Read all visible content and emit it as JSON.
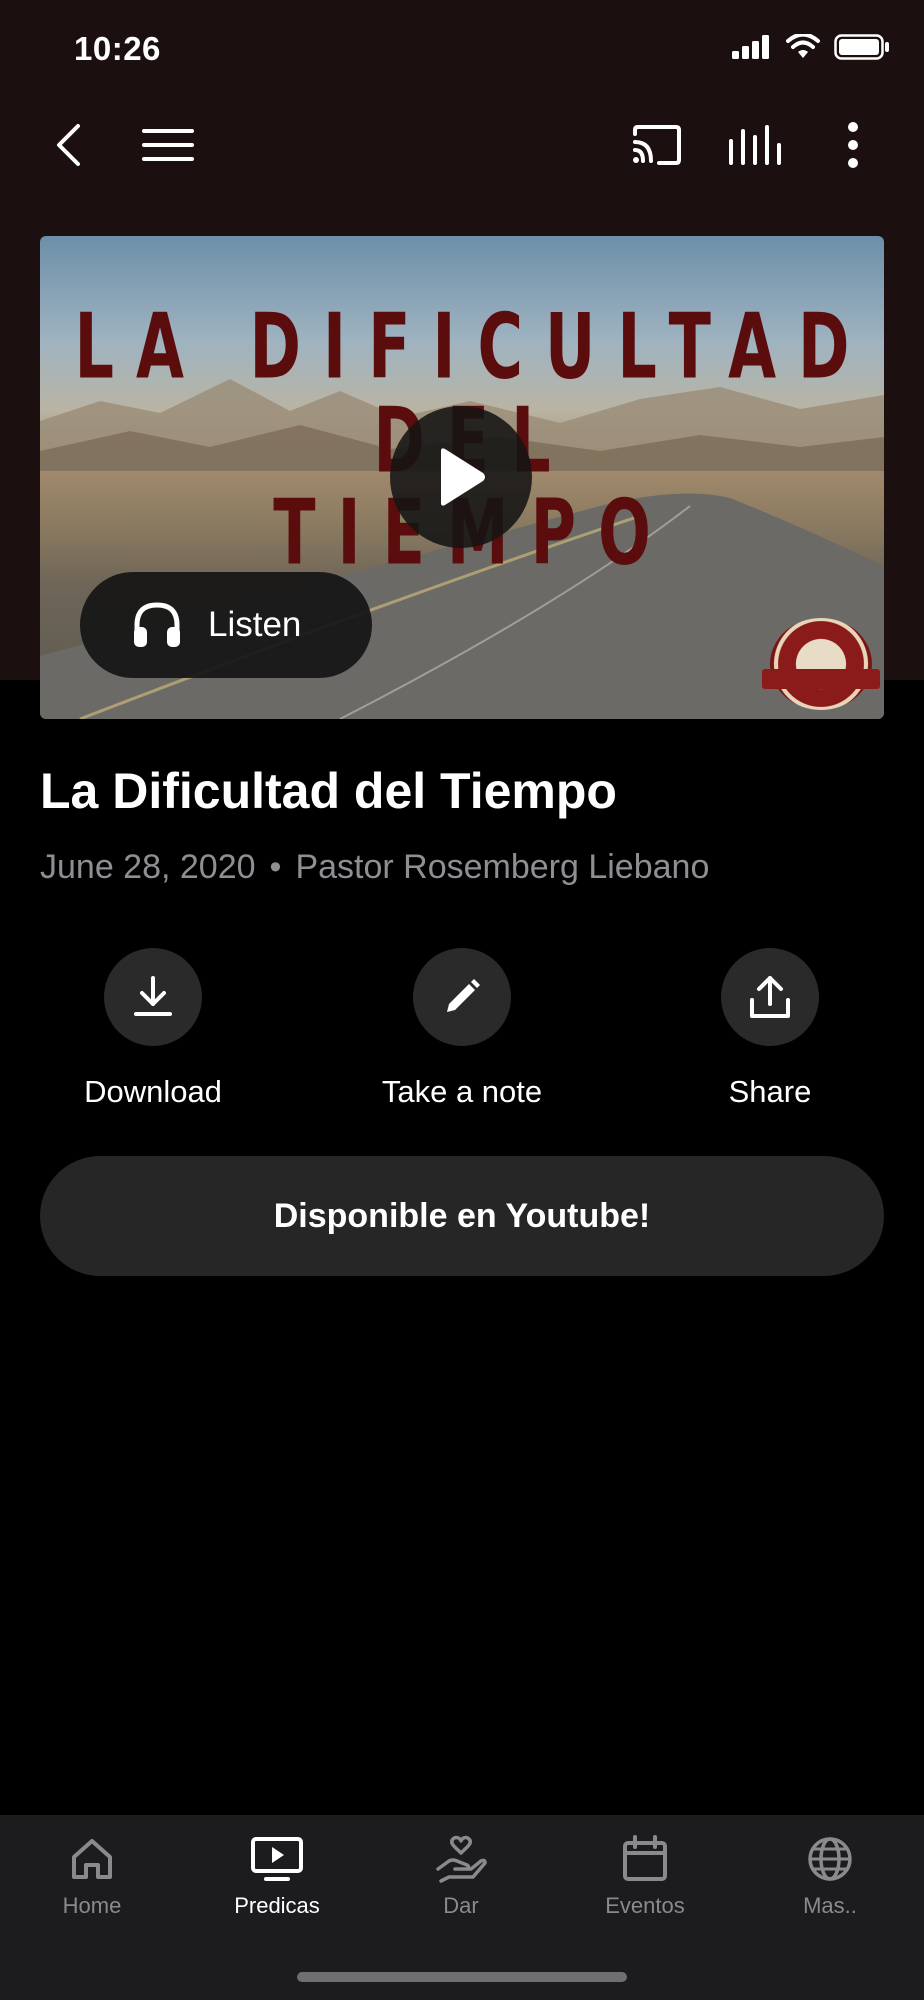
{
  "status": {
    "time": "10:26"
  },
  "hero": {
    "title_lines": [
      "LA DIFICULTAD",
      "DEL",
      "TIEMPO"
    ],
    "listen_label": "Listen"
  },
  "sermon": {
    "title": "La Dificultad del Tiempo",
    "date": "June 28, 2020",
    "separator": "•",
    "speaker": "Pastor Rosemberg Liebano"
  },
  "actions": {
    "download": "Download",
    "note": "Take a note",
    "share": "Share"
  },
  "youtube_button": "Disponible en Youtube!",
  "tabs": [
    {
      "label": "Home",
      "icon": "home-icon"
    },
    {
      "label": "Predicas",
      "icon": "tv-play-icon",
      "active": true
    },
    {
      "label": "Dar",
      "icon": "hand-heart-icon"
    },
    {
      "label": "Eventos",
      "icon": "calendar-icon"
    },
    {
      "label": "Mas..",
      "icon": "globe-icon"
    }
  ],
  "colors": {
    "header_bg": "#1c0f0f",
    "title_red": "#5b0d0d",
    "tab_bar": "#1c1c1e",
    "button_bg": "#262626"
  }
}
